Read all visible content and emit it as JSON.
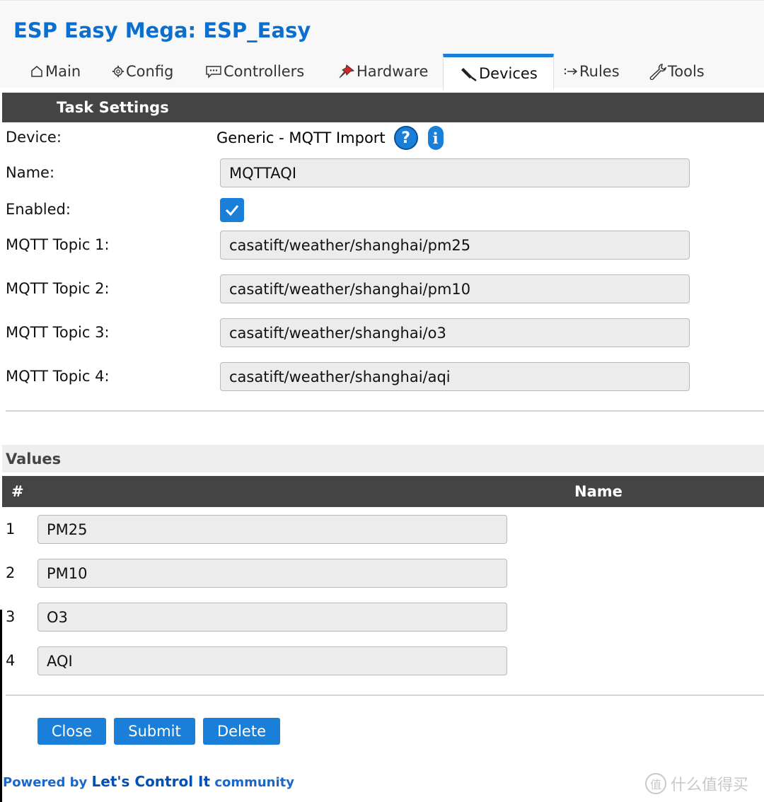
{
  "app": {
    "title": "ESP Easy Mega: ESP_Easy"
  },
  "tabs": [
    {
      "label": "Main",
      "icon": "home-icon"
    },
    {
      "label": "Config",
      "icon": "gear-icon"
    },
    {
      "label": "Controllers",
      "icon": "chat-icon"
    },
    {
      "label": "Hardware",
      "icon": "pin-icon"
    },
    {
      "label": "Devices",
      "icon": "plug-icon",
      "active": true
    },
    {
      "label": "Rules",
      "icon": "arrow-icon"
    },
    {
      "label": "Tools",
      "icon": "wrench-icon"
    }
  ],
  "task_settings": {
    "header": "Task Settings",
    "device_label": "Device:",
    "device_value": "Generic - MQTT Import",
    "name_label": "Name:",
    "name_value": "MQTTAQI",
    "enabled_label": "Enabled:",
    "enabled": true,
    "topics": [
      {
        "label": "MQTT Topic 1:",
        "value": "casatift/weather/shanghai/pm25"
      },
      {
        "label": "MQTT Topic 2:",
        "value": "casatift/weather/shanghai/pm10"
      },
      {
        "label": "MQTT Topic 3:",
        "value": "casatift/weather/shanghai/o3"
      },
      {
        "label": "MQTT Topic 4:",
        "value": "casatift/weather/shanghai/aqi"
      }
    ]
  },
  "values": {
    "header": "Values",
    "col_num": "#",
    "col_name": "Name",
    "rows": [
      {
        "num": "1",
        "name": "PM25"
      },
      {
        "num": "2",
        "name": "PM10"
      },
      {
        "num": "3",
        "name": "O3"
      },
      {
        "num": "4",
        "name": "AQI"
      }
    ]
  },
  "buttons": {
    "close": "Close",
    "submit": "Submit",
    "delete": "Delete"
  },
  "footer": {
    "prefix": "Powered by",
    "brand": "Let's Control It",
    "suffix": "community"
  },
  "watermark": {
    "text": "什么值得买",
    "icon_char": "值"
  },
  "colors": {
    "accent": "#1a7fd8",
    "title": "#0a6fcf",
    "section_bar": "#444444",
    "field_bg": "#ececec"
  }
}
